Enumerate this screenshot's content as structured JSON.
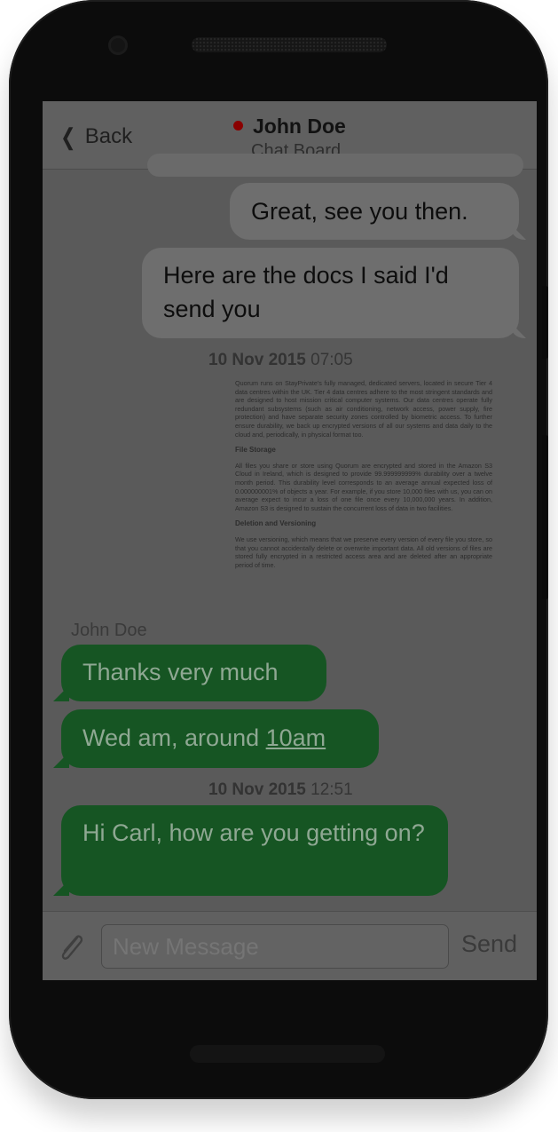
{
  "header": {
    "back_label": "Back",
    "contact_name": "John Doe",
    "subtitle": "Chat Board",
    "status_color": "#8a0000"
  },
  "messages": [
    {
      "type": "outgoing",
      "text": "Great, see you then."
    },
    {
      "type": "outgoing",
      "text": "Here are the docs I said I'd send you"
    },
    {
      "type": "timestamp",
      "date": "10 Nov 2015",
      "time": "07:05"
    },
    {
      "type": "document",
      "paragraph1": "Quorum runs on StayPrivate's fully managed, dedicated servers, located in secure Tier 4 data centres within the UK. Tier 4 data centres adhere to the most stringent standards and are designed to host mission critical computer systems. Our data centres operate fully redundant subsystems (such as air conditioning, network access, power supply, fire protection) and have separate security zones controlled by biometric access. To further ensure durability, we back up encrypted versions of all our systems and data daily to the cloud and, periodically, in physical format too.",
      "heading1": "File Storage",
      "paragraph2": "All files you share or store using Quorum are encrypted and stored in the Amazon S3 Cloud in Ireland, which is designed to provide 99.999999999% durability over a twelve month period. This durability level corresponds to an average annual expected loss of 0.000000001% of objects a year. For example, if you store 10,000 files with us, you can on average expect to incur a loss of one file once every 10,000,000 years. In addition, Amazon S3 is designed to sustain the concurrent loss of data in two facilities.",
      "heading2": "Deletion and Versioning",
      "paragraph3": "We use versioning, which means that we preserve every version of every file you store, so that you cannot accidentally delete or overwrite important data. All old versions of files are stored fully encrypted in a restricted access area and are deleted after an appropriate period of time."
    },
    {
      "type": "sender",
      "text": "John Doe"
    },
    {
      "type": "incoming",
      "text": "Thanks very much"
    },
    {
      "type": "incoming",
      "text_before": "Wed am, around ",
      "link": "10am"
    },
    {
      "type": "timestamp",
      "date": "10 Nov 2015",
      "time": "12:51"
    },
    {
      "type": "incoming",
      "text": "Hi Carl, how are you getting on?"
    }
  ],
  "composer": {
    "placeholder": "New Message",
    "send_label": "Send"
  },
  "colors": {
    "incoming_bubble": "#165523",
    "outgoing_bubble": "#6e6e6e"
  }
}
